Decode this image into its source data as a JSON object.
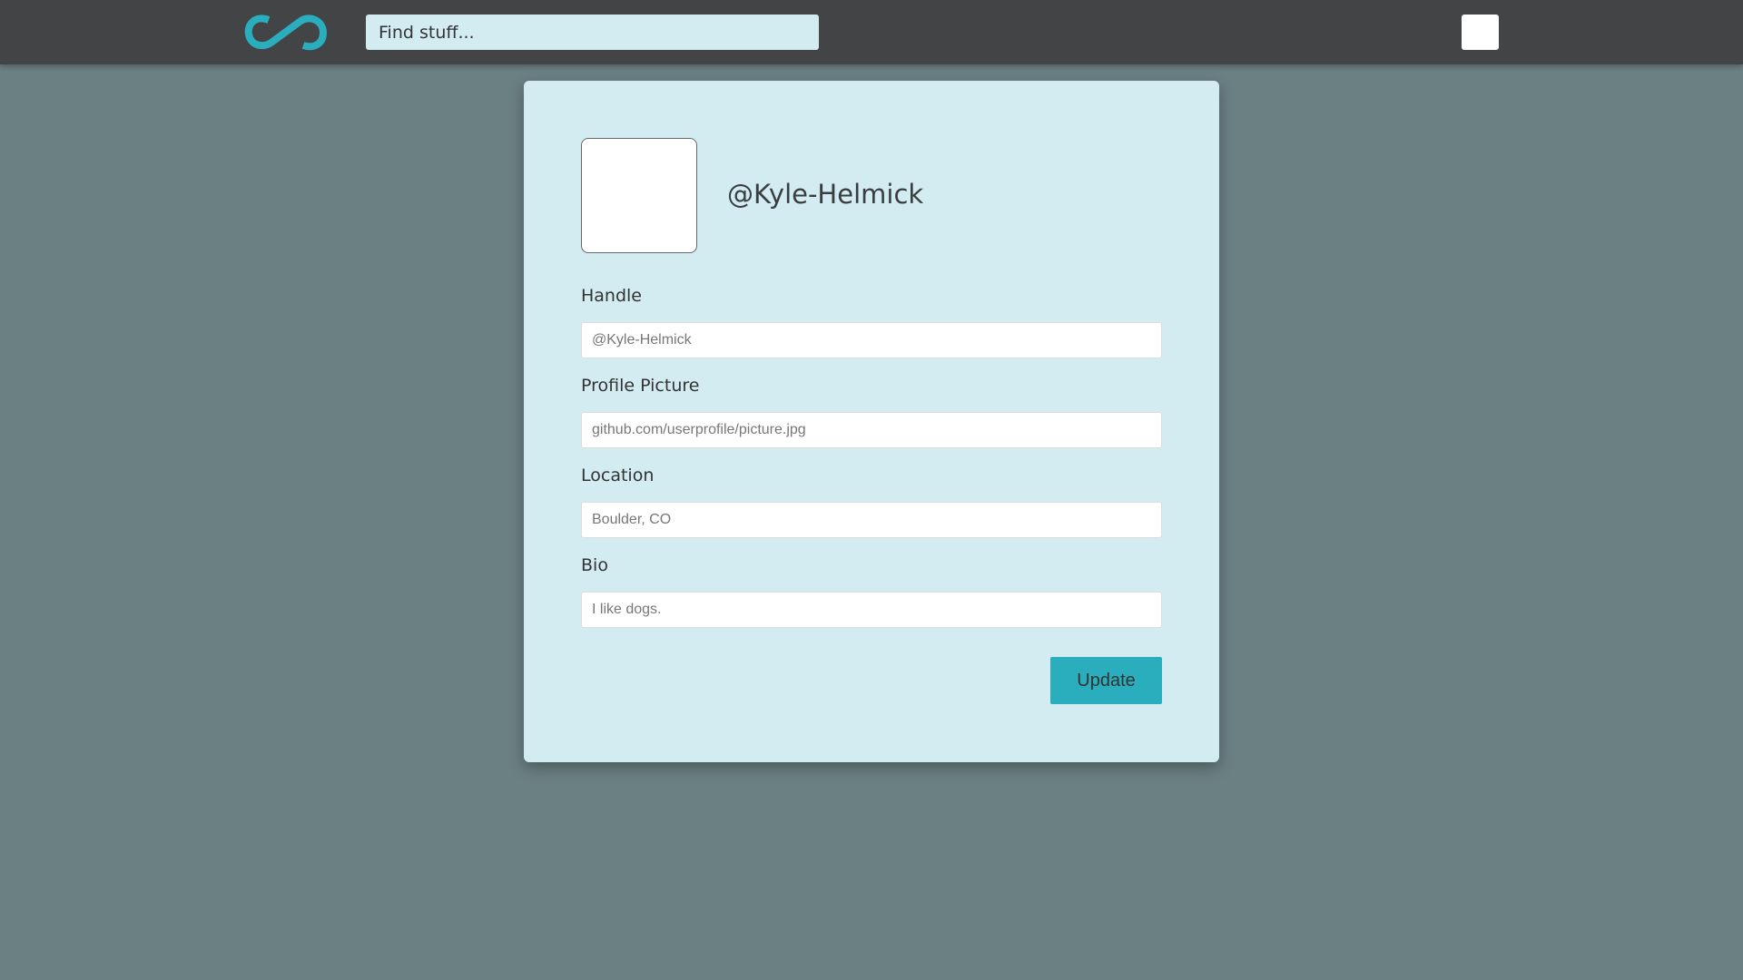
{
  "nav": {
    "search_placeholder": "Find stuff...",
    "logo_icon": "infinity-logo-icon"
  },
  "profile": {
    "handle_title": "@Kyle-Helmick"
  },
  "form": {
    "handle": {
      "label": "Handle",
      "placeholder": "@Kyle-Helmick"
    },
    "picture": {
      "label": "Profile Picture",
      "placeholder": "github.com/userprofile/picture.jpg"
    },
    "location": {
      "label": "Location",
      "placeholder": "Boulder, CO"
    },
    "bio": {
      "label": "Bio",
      "placeholder": "I like dogs."
    },
    "submit_label": "Update"
  },
  "colors": {
    "accent": "#2aadbd",
    "navbar": "#424446",
    "background": "#6b8083",
    "card": "#d3ecf1"
  }
}
